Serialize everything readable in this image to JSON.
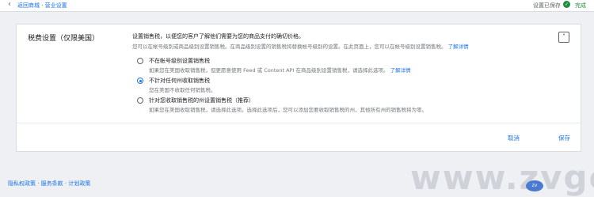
{
  "topbar": {
    "breadcrumb": "返回商城 · 营业设置",
    "settings_status": "设置已保存",
    "saved_text": "完成"
  },
  "tax": {
    "title": "税费设置（仅限美国）",
    "desc_line1": "设置销售税，以便您的客户了解他们需要为您的商品支付的确切价格。",
    "desc_line2": "您可以在帐号级别或商品级别设置销售税。在商品级别设置的销售税将替换帐号级别的设置。在此页面上，您可以在帐号级别设置销售税。",
    "desc_link": "了解详情",
    "options": [
      {
        "label": "不在帐号级别设置销售税",
        "desc": "如果您在美国收取销售税，但更愿意使用 Feed 或 Content API 在商品级别设置销售税，请选择此选项。",
        "desc_link": "了解详情",
        "selected": false
      },
      {
        "label": "不针对任何州收取销售税",
        "desc": "您在美国不收取任何销售税。",
        "desc_link": "",
        "selected": true
      },
      {
        "label": "针对您收取销售税的州设置销售税（推荐）",
        "desc": "如果您在美国收取销售税，请选择此选项。选择此选项后，您可以添加您要收取销售税的州，其他所有州的销售税将为零。",
        "desc_link": "",
        "selected": false
      }
    ],
    "cancel_label": "取消",
    "save_label": "保存"
  },
  "footer": {
    "links": "隐私权政策 · 服务条款 · 计划政策"
  },
  "watermark": {
    "text": "www.zvge.cn",
    "badge": "zv"
  },
  "colors": {
    "accent": "#1a73e8",
    "background": "#eef0f3",
    "success": "#1e8e3e"
  },
  "icons": [
    "back-arrow-icon",
    "check-icon",
    "chevron-up-icon",
    "cursor-icon"
  ]
}
